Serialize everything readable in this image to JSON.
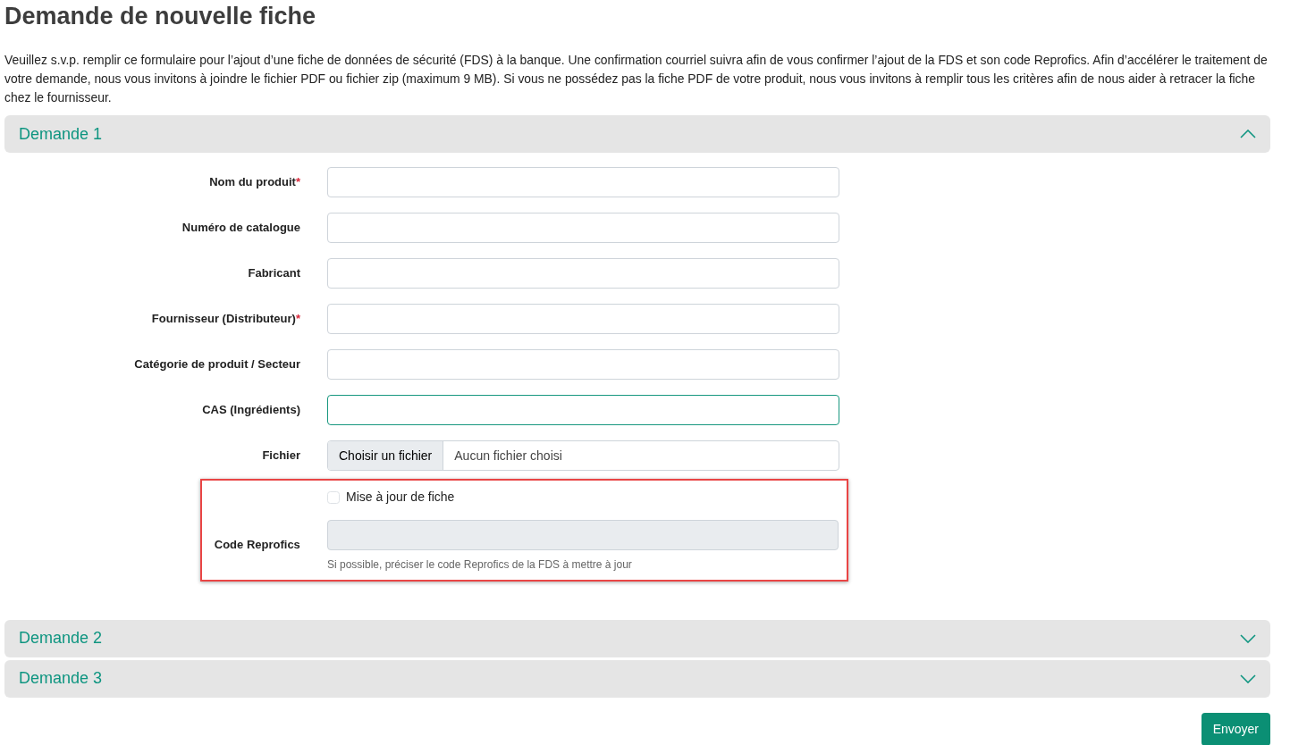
{
  "title": "Demande de nouvelle fiche",
  "intro": "Veuillez s.v.p. remplir ce formulaire pour l’ajout d’une fiche de données de sécurité (FDS) à la banque. Une confirmation courriel suivra afin de vous confirmer l’ajout de la FDS et son code Reprofics. Afin d’accélérer le traitement de votre demande, nous vous invitons à joindre le fichier PDF ou fichier zip (maximum 9 MB). Si vous ne possédez pas la fiche PDF de votre produit, nous vous invitons à remplir tous les critères afin de nous aider à retracer la fiche chez le fournisseur.",
  "demandes": [
    {
      "title": "Demande 1",
      "expanded": true,
      "fields": [
        {
          "kind": "text",
          "label": "Nom du produit",
          "required_mark": "*",
          "focused": false
        },
        {
          "kind": "text",
          "label": "Numéro de catalogue",
          "focused": false
        },
        {
          "kind": "text",
          "label": "Fabricant",
          "focused": false
        },
        {
          "kind": "text",
          "label": "Fournisseur (Distributeur)",
          "required_mark": "*",
          "focused": false
        },
        {
          "kind": "text",
          "label": "Catégorie de produit / Secteur",
          "focused": false
        },
        {
          "kind": "text",
          "label": "CAS (Ingrédients)",
          "focused": true
        },
        {
          "kind": "file",
          "label": "Fichier",
          "button": "Choisir un fichier",
          "status": "Aucun fichier choisi"
        },
        {
          "kind": "update",
          "highlighted": true,
          "checkbox_label": "Mise à jour de fiche",
          "checked": false,
          "label": "Code Reprofics",
          "disabled": true,
          "help": "Si possible, préciser le code Reprofics de la FDS à mettre à jour"
        }
      ]
    },
    {
      "title": "Demande 2",
      "expanded": false
    },
    {
      "title": "Demande 3",
      "expanded": false
    }
  ],
  "submit": "Envoyer"
}
